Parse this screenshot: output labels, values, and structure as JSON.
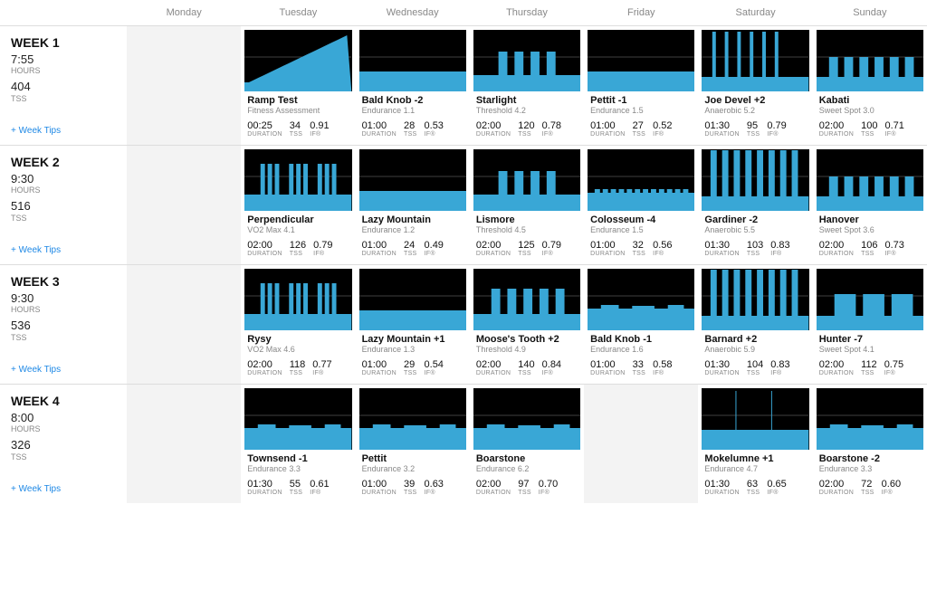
{
  "days": [
    "Monday",
    "Tuesday",
    "Wednesday",
    "Thursday",
    "Friday",
    "Saturday",
    "Sunday"
  ],
  "labels": {
    "duration": "DURATION",
    "tss": "TSS",
    "if": "IF®",
    "hours": "HOURS",
    "tss_caps": "TSS",
    "week_tips": "+ Week Tips"
  },
  "weeks": [
    {
      "title": "WEEK 1",
      "hours": "7:55",
      "tss": "404",
      "workouts": [
        null,
        {
          "name": "Ramp Test",
          "type": "Fitness Assessment",
          "duration": "00:25",
          "tss": "34",
          "if": "0.91",
          "shape": "ramp"
        },
        {
          "name": "Bald Knob -2",
          "type": "Endurance 1.1",
          "duration": "01:00",
          "tss": "28",
          "if": "0.53",
          "shape": "endurance_low"
        },
        {
          "name": "Starlight",
          "type": "Threshold 4.2",
          "duration": "02:00",
          "tss": "120",
          "if": "0.78",
          "shape": "threshold_blocks"
        },
        {
          "name": "Pettit -1",
          "type": "Endurance 1.5",
          "duration": "01:00",
          "tss": "27",
          "if": "0.52",
          "shape": "endurance_low"
        },
        {
          "name": "Joe Devel +2",
          "type": "Anaerobic 5.2",
          "duration": "01:30",
          "tss": "95",
          "if": "0.79",
          "shape": "anaerobic_spikes"
        },
        {
          "name": "Kabati",
          "type": "Sweet Spot 3.0",
          "duration": "02:00",
          "tss": "100",
          "if": "0.71",
          "shape": "sweetspot_intervals"
        }
      ]
    },
    {
      "title": "WEEK 2",
      "hours": "9:30",
      "tss": "516",
      "workouts": [
        null,
        {
          "name": "Perpendicular",
          "type": "VO2 Max 4.1",
          "duration": "02:00",
          "tss": "126",
          "if": "0.79",
          "shape": "vo2_blocks"
        },
        {
          "name": "Lazy Mountain",
          "type": "Endurance 1.2",
          "duration": "01:00",
          "tss": "24",
          "if": "0.49",
          "shape": "endurance_low"
        },
        {
          "name": "Lismore",
          "type": "Threshold 4.5",
          "duration": "02:00",
          "tss": "125",
          "if": "0.79",
          "shape": "threshold_blocks"
        },
        {
          "name": "Colosseum -4",
          "type": "Endurance 1.5",
          "duration": "01:00",
          "tss": "32",
          "if": "0.56",
          "shape": "endurance_bumpy"
        },
        {
          "name": "Gardiner -2",
          "type": "Anaerobic 5.5",
          "duration": "01:30",
          "tss": "103",
          "if": "0.83",
          "shape": "anaerobic_tall"
        },
        {
          "name": "Hanover",
          "type": "Sweet Spot 3.6",
          "duration": "02:00",
          "tss": "106",
          "if": "0.73",
          "shape": "sweetspot_intervals"
        }
      ]
    },
    {
      "title": "WEEK 3",
      "hours": "9:30",
      "tss": "536",
      "workouts": [
        null,
        {
          "name": "Rysy",
          "type": "VO2 Max 4.6",
          "duration": "02:00",
          "tss": "118",
          "if": "0.77",
          "shape": "vo2_blocks"
        },
        {
          "name": "Lazy Mountain +1",
          "type": "Endurance 1.3",
          "duration": "01:00",
          "tss": "29",
          "if": "0.54",
          "shape": "endurance_low"
        },
        {
          "name": "Moose's Tooth +2",
          "type": "Threshold 4.9",
          "duration": "02:00",
          "tss": "140",
          "if": "0.84",
          "shape": "threshold_blocks2"
        },
        {
          "name": "Bald Knob -1",
          "type": "Endurance 1.6",
          "duration": "01:00",
          "tss": "33",
          "if": "0.58",
          "shape": "endurance_mid"
        },
        {
          "name": "Barnard +2",
          "type": "Anaerobic 5.9",
          "duration": "01:30",
          "tss": "104",
          "if": "0.83",
          "shape": "anaerobic_tall"
        },
        {
          "name": "Hunter -7",
          "type": "Sweet Spot 4.1",
          "duration": "02:00",
          "tss": "112",
          "if": "0.75",
          "shape": "sweetspot_wide"
        }
      ]
    },
    {
      "title": "WEEK 4",
      "hours": "8:00",
      "tss": "326",
      "workouts": [
        null,
        {
          "name": "Townsend -1",
          "type": "Endurance 3.3",
          "duration": "01:30",
          "tss": "55",
          "if": "0.61",
          "shape": "endurance_mid"
        },
        {
          "name": "Pettit",
          "type": "Endurance 3.2",
          "duration": "01:00",
          "tss": "39",
          "if": "0.63",
          "shape": "endurance_mid"
        },
        {
          "name": "Boarstone",
          "type": "Endurance 6.2",
          "duration": "02:00",
          "tss": "97",
          "if": "0.70",
          "shape": "endurance_mid"
        },
        null,
        {
          "name": "Mokelumne +1",
          "type": "Endurance 4.7",
          "duration": "01:30",
          "tss": "63",
          "if": "0.65",
          "shape": "endurance_lines"
        },
        {
          "name": "Boarstone -2",
          "type": "Endurance 3.3",
          "duration": "02:00",
          "tss": "72",
          "if": "0.60",
          "shape": "endurance_mid"
        }
      ]
    }
  ]
}
